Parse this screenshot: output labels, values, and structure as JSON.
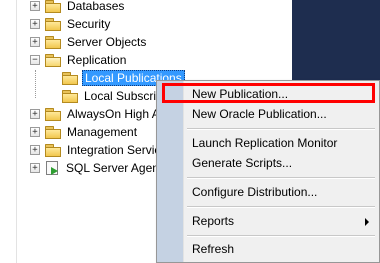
{
  "object_explorer": {
    "nodes": [
      {
        "label": "Databases"
      },
      {
        "label": "Security"
      },
      {
        "label": "Server Objects"
      },
      {
        "label": "Replication"
      },
      {
        "label": "Local Publications"
      },
      {
        "label": "Local Subscrip"
      },
      {
        "label": "AlwaysOn High A"
      },
      {
        "label": "Management"
      },
      {
        "label": "Integration Servic"
      },
      {
        "label": "SQL Server Agent"
      }
    ]
  },
  "context_menu": {
    "items": [
      {
        "label": "New Publication..."
      },
      {
        "label": "New Oracle Publication..."
      },
      {
        "label": "Launch Replication Monitor"
      },
      {
        "label": "Generate Scripts..."
      },
      {
        "label": "Configure Distribution..."
      },
      {
        "label": "Reports"
      },
      {
        "label": "Refresh"
      }
    ]
  },
  "colors": {
    "selection": "#3399ff",
    "highlight_box": "#ff0000",
    "menu_gutter": "#c5d2e3",
    "dark_panel": "#1e2d4f"
  }
}
